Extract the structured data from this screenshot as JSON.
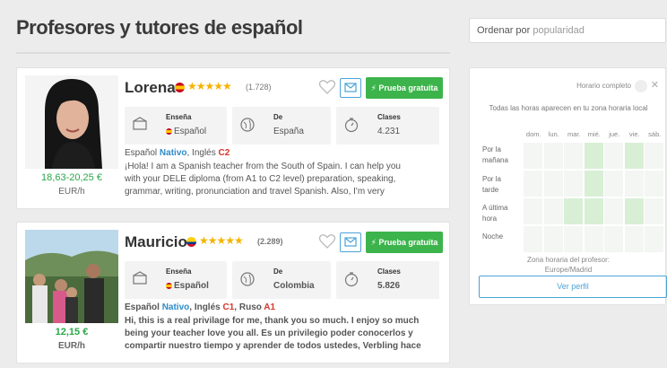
{
  "page": {
    "title": "Profesores y tutores de español"
  },
  "sort": {
    "prefix": "Ordenar por",
    "value": "popularidad"
  },
  "teachers": [
    {
      "name": "Lorena",
      "rating_stars": 5,
      "stars": "★★★★★",
      "reviews": "(1.728)",
      "trial_label": "⚡ Prueba gratuita",
      "price": "18,63-20,25 €",
      "price_unit": "EUR/h",
      "stats": [
        {
          "label": "Enseña",
          "value": "Español",
          "icon": "teach-icon"
        },
        {
          "label": "De",
          "value": "España",
          "icon": "globe-icon"
        },
        {
          "label": "Clases",
          "value": "4.231",
          "icon": "stopwatch-icon"
        }
      ],
      "langs": {
        "l1": "Español",
        "l1_level": "Nativo",
        "sep": ", ",
        "l2": "Inglés",
        "l2_level": "C2"
      },
      "description": "¡Hola! I am a Spanish teacher from the South of Spain.  I can help you\nwith your DELE diploma (from A1 to C2 level) preparation, speaking,\ngrammar, writing, pronunciation and travel Spanish. Also, I'm very"
    },
    {
      "name": "Mauricio",
      "rating_stars": 5,
      "stars": "★★★★★",
      "reviews": "(2.289)",
      "trial_label": "⚡ Prueba gratuita",
      "price": "12,15 €",
      "price_unit": "EUR/h",
      "stats": [
        {
          "label": "Enseña",
          "value": "Español",
          "icon": "teach-icon"
        },
        {
          "label": "De",
          "value": "Colombia",
          "icon": "globe-icon"
        },
        {
          "label": "Clases",
          "value": "5.826",
          "icon": "stopwatch-icon"
        }
      ],
      "langs": {
        "l1": "Español",
        "l1_level": "Nativo",
        "sep": ", ",
        "l2": "Inglés",
        "l2_level": "C1",
        "sep2": ", ",
        "l3": "Ruso",
        "l3_level": "A1"
      },
      "description": "Hi, this is a real privilage for me, thank you so much. I enjoy so much\nbeing your teacher love you all. Es un privilegio poder conocerlos y\ncompartir nuestro tiempo y aprender de todos ustedes, Verbling hace"
    }
  ],
  "schedule": {
    "full_label": "Horario completo",
    "note": "Todas las horas aparecen en tu zona horaria local",
    "days": [
      "dom.",
      "lun.",
      "mar.",
      "mié.",
      "jue.",
      "vie.",
      "sáb."
    ],
    "rows": [
      {
        "label": "Por la\nmañana",
        "avail": [
          0,
          0,
          0,
          1,
          0,
          1,
          0
        ]
      },
      {
        "label": "Por la\ntarde",
        "avail": [
          0,
          0,
          0,
          1,
          0,
          0,
          0
        ]
      },
      {
        "label": "A última\nhora",
        "avail": [
          0,
          0,
          1,
          1,
          0,
          1,
          0
        ]
      },
      {
        "label": "Noche",
        "avail": [
          0,
          0,
          0,
          0,
          0,
          0,
          0
        ]
      }
    ],
    "tz_label": "Zona horaria del profesor:",
    "tz_value": "Europe/Madrid",
    "profile_button": "Ver perfil"
  },
  "colors": {
    "green": "#3cb44b",
    "blue": "#4aa3d8",
    "price": "#2aa84a",
    "star": "#f5b300",
    "level_red": "#d9342b"
  }
}
